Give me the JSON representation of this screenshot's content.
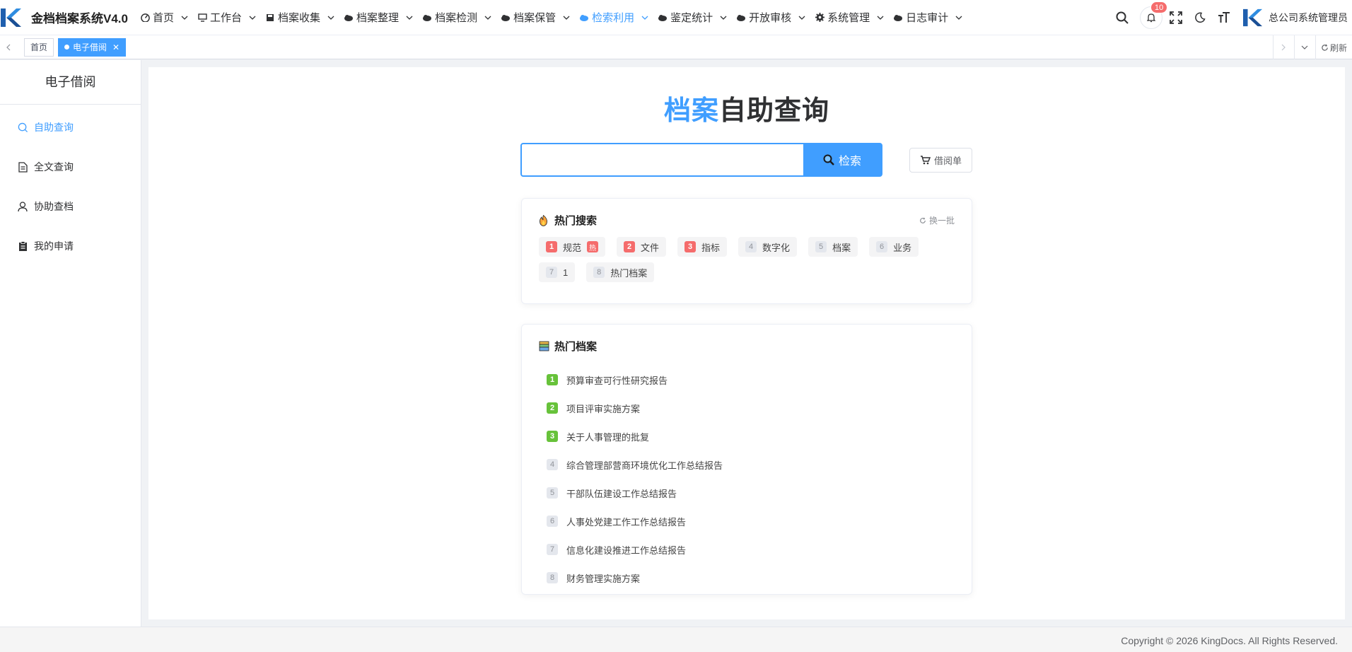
{
  "app": {
    "title": "金档档案系统V4.0"
  },
  "nav": {
    "items": [
      {
        "label": "首页",
        "icon": "dashboard-icon"
      },
      {
        "label": "工作台",
        "icon": "monitor-icon"
      },
      {
        "label": "档案收集",
        "icon": "save-icon"
      },
      {
        "label": "档案整理",
        "icon": "cloud-icon"
      },
      {
        "label": "档案检测",
        "icon": "cloud-icon"
      },
      {
        "label": "档案保管",
        "icon": "cloud-icon"
      },
      {
        "label": "检索利用",
        "icon": "cloud-icon",
        "active": true
      },
      {
        "label": "鉴定统计",
        "icon": "cloud-icon"
      },
      {
        "label": "开放审核",
        "icon": "cloud-icon"
      },
      {
        "label": "系统管理",
        "icon": "gear-icon"
      },
      {
        "label": "日志审计",
        "icon": "cloud-icon"
      }
    ]
  },
  "header": {
    "notifications": "10",
    "user": "总公司系统管理员"
  },
  "tags": {
    "home": "首页",
    "current": "电子借阅",
    "refresh": "刷新"
  },
  "sidebar": {
    "title": "电子借阅",
    "items": [
      {
        "label": "自助查询",
        "icon": "search-icon",
        "active": true
      },
      {
        "label": "全文查询",
        "icon": "document-icon"
      },
      {
        "label": "协助查档",
        "icon": "user-icon"
      },
      {
        "label": "我的申请",
        "icon": "clipboard-icon"
      }
    ]
  },
  "main": {
    "title_accent": "档案",
    "title_rest": "自助查询",
    "search": {
      "placeholder": "",
      "value": "",
      "button": "检索"
    },
    "borrow_button": "借阅单",
    "hot_search": {
      "title": "热门搜索",
      "refresh": "换一批",
      "hot_badge": "热",
      "items": [
        {
          "rank": "1",
          "label": "规范",
          "hot": true
        },
        {
          "rank": "2",
          "label": "文件",
          "hot": true
        },
        {
          "rank": "3",
          "label": "指标",
          "hot": true
        },
        {
          "rank": "4",
          "label": "数字化",
          "hot": false
        },
        {
          "rank": "5",
          "label": "档案",
          "hot": false
        },
        {
          "rank": "6",
          "label": "业务",
          "hot": false
        },
        {
          "rank": "7",
          "label": "1",
          "hot": false
        },
        {
          "rank": "8",
          "label": "热门档案",
          "hot": false
        }
      ]
    },
    "hot_archives": {
      "title": "热门档案",
      "items": [
        {
          "rank": "1",
          "label": "预算审查可行性研究报告",
          "top": true
        },
        {
          "rank": "2",
          "label": "项目评审实施方案",
          "top": true
        },
        {
          "rank": "3",
          "label": "关于人事管理的批复",
          "top": true
        },
        {
          "rank": "4",
          "label": "综合管理部营商环境优化工作总结报告",
          "top": false
        },
        {
          "rank": "5",
          "label": "干部队伍建设工作总结报告",
          "top": false
        },
        {
          "rank": "6",
          "label": "人事处党建工作工作总结报告",
          "top": false
        },
        {
          "rank": "7",
          "label": "信息化建设推进工作总结报告",
          "top": false
        },
        {
          "rank": "8",
          "label": "财务管理实施方案",
          "top": false
        }
      ]
    }
  },
  "footer": {
    "copyright": "Copyright © 2026 KingDocs. All Rights Reserved."
  },
  "colors": {
    "primary": "#409eff",
    "hot": "#f56c6c",
    "top": "#67c23a"
  }
}
